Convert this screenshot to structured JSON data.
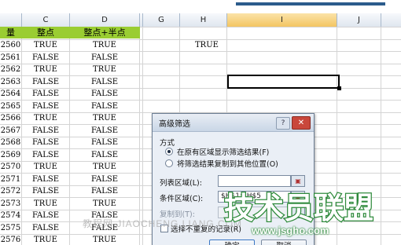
{
  "columns": [
    {
      "letter": "",
      "selected": false
    },
    {
      "letter": "C",
      "selected": false
    },
    {
      "letter": "D",
      "selected": false
    },
    {
      "letter": "",
      "selected": false
    },
    {
      "letter": "G",
      "selected": false
    },
    {
      "letter": "H",
      "selected": false
    },
    {
      "letter": "I",
      "selected": true
    },
    {
      "letter": "J",
      "selected": false
    }
  ],
  "header_row": {
    "col_b_partial": "量",
    "col_c": "整点",
    "col_d": "整点+半点"
  },
  "rows": [
    {
      "n": "2560",
      "c": "TRUE",
      "d": "TRUE"
    },
    {
      "n": "2561",
      "c": "FALSE",
      "d": "FALSE"
    },
    {
      "n": "2562",
      "c": "TRUE",
      "d": "TRUE"
    },
    {
      "n": "2563",
      "c": "FALSE",
      "d": "FALSE"
    },
    {
      "n": "2564",
      "c": "FALSE",
      "d": "FALSE"
    },
    {
      "n": "2565",
      "c": "FALSE",
      "d": "FALSE"
    },
    {
      "n": "2566",
      "c": "TRUE",
      "d": "TRUE"
    },
    {
      "n": "2567",
      "c": "FALSE",
      "d": "FALSE"
    },
    {
      "n": "2568",
      "c": "FALSE",
      "d": "FALSE"
    },
    {
      "n": "2569",
      "c": "FALSE",
      "d": "FALSE"
    },
    {
      "n": "2570",
      "c": "TRUE",
      "d": "TRUE"
    },
    {
      "n": "2571",
      "c": "FALSE",
      "d": "FALSE"
    },
    {
      "n": "2572",
      "c": "FALSE",
      "d": "FALSE"
    },
    {
      "n": "2573",
      "c": "TRUE",
      "d": "TRUE"
    },
    {
      "n": "2574",
      "c": "FALSE",
      "d": "FALSE"
    },
    {
      "n": "2575",
      "c": "FALSE",
      "d": "FALSE"
    },
    {
      "n": "2576",
      "c": "TRUE",
      "d": "TRUE"
    }
  ],
  "criteria_cell": {
    "value": "TRUE"
  },
  "dialog": {
    "title": "高级筛选",
    "help_label": "?",
    "close_label": "✕",
    "mode_label": "方式",
    "option_in_place": "在原有区域显示筛选结果(F)",
    "option_copy": "将筛选结果复制到其他位置(O)",
    "list_range_label": "列表区域(L):",
    "list_range_value": "",
    "criteria_range_label": "条件区域(C):",
    "criteria_range_value": "$H$1:$H$5",
    "copy_to_label": "复制到(T):",
    "copy_to_value": "",
    "unique_label": "选择不重复的记录(R)",
    "ok_label": "确定",
    "cancel_label": "取消",
    "selected_option": "in_place"
  },
  "watermarks": {
    "left_text": "教程网 JIAOCHENG.LIANG.COM",
    "brand_text": "技术员联盟",
    "url_text": "www.jsgho.com"
  },
  "colors": {
    "header_green": "#9acd32",
    "selection": "#000000",
    "brand_green": "#2e8a3b"
  }
}
